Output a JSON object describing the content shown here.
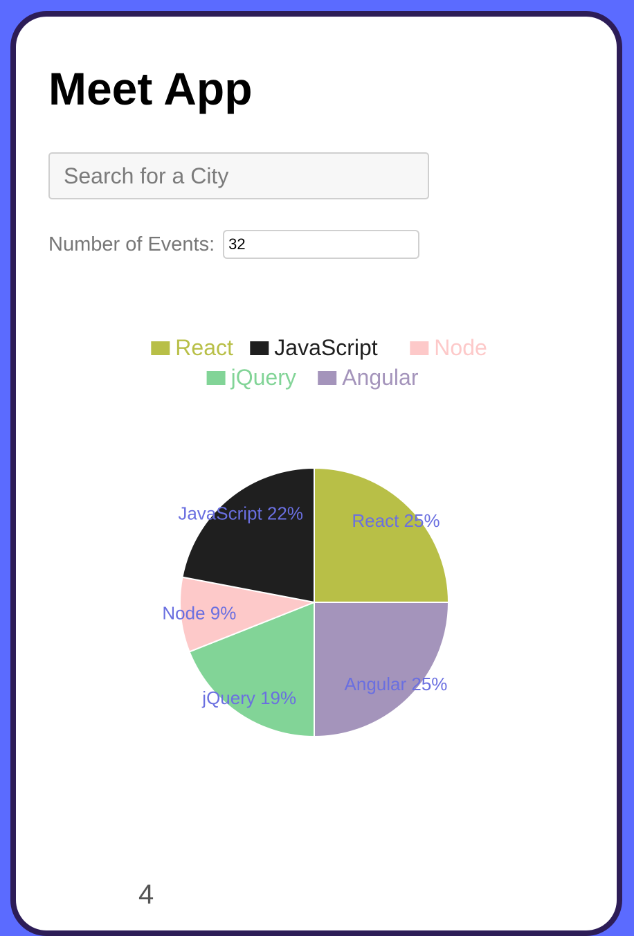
{
  "app": {
    "title": "Meet App"
  },
  "search": {
    "placeholder": "Search for a City",
    "value": ""
  },
  "events": {
    "label": "Number of Events:",
    "value": "32"
  },
  "chart_data": {
    "type": "pie",
    "title": "",
    "legend_placement": "top",
    "slices": [
      {
        "label": "React",
        "value": 25,
        "color": "#b8bf47"
      },
      {
        "label": "JavaScript",
        "value": 22,
        "color": "#1f1f1f"
      },
      {
        "label": "Node",
        "value": 9,
        "color": "#fdc9c9"
      },
      {
        "label": "jQuery",
        "value": 19,
        "color": "#82d497"
      },
      {
        "label": "Angular",
        "value": 25,
        "color": "#a494bb"
      }
    ],
    "data_label_color": "#6a6fe0",
    "legend_order": [
      "React",
      "JavaScript",
      "Node",
      "jQuery",
      "Angular"
    ]
  },
  "footer": {
    "partial_text": "4"
  }
}
